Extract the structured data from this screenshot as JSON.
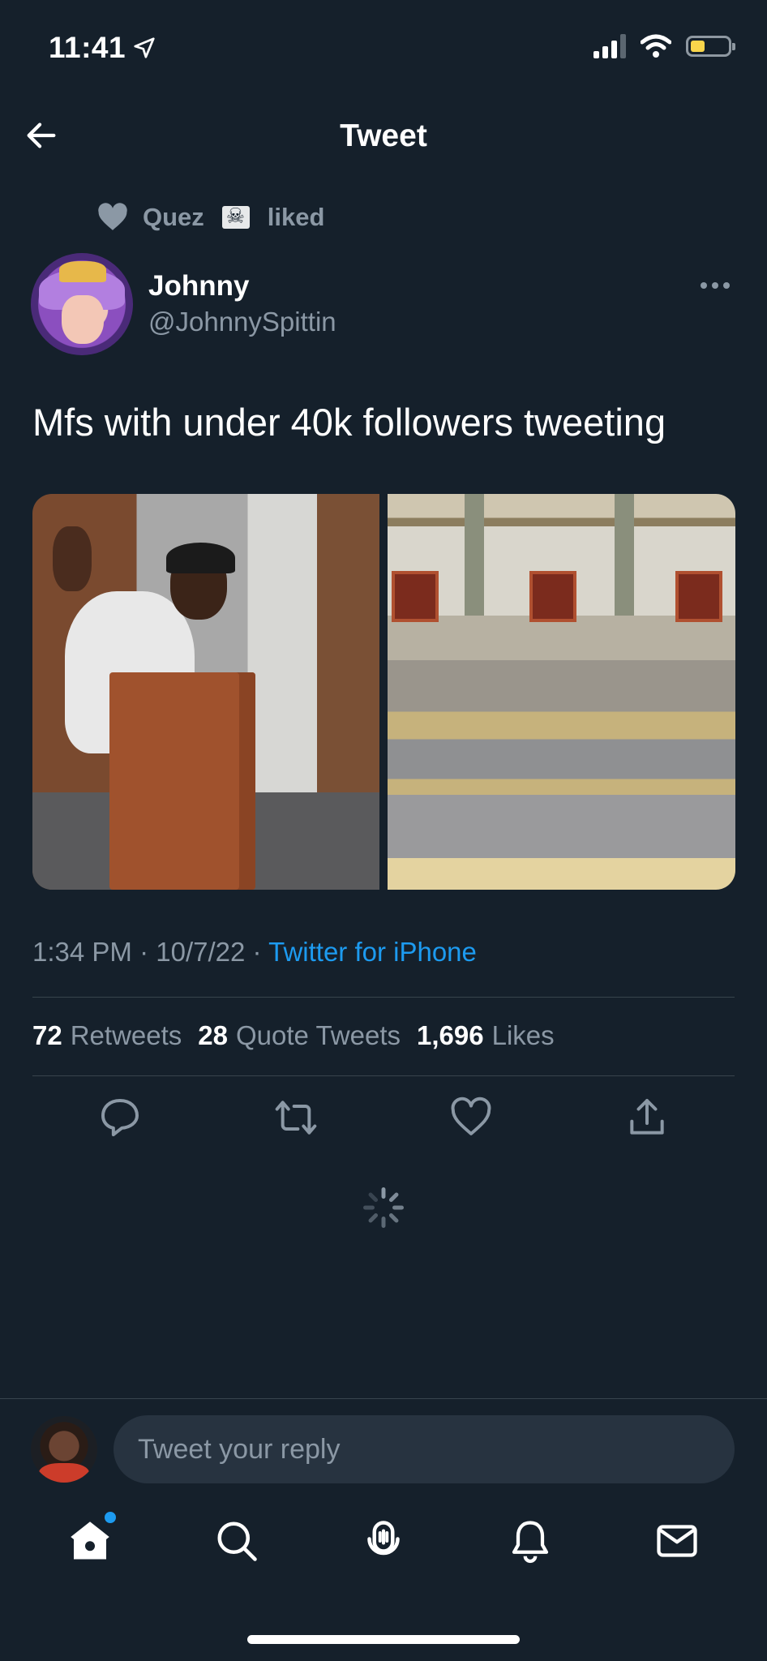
{
  "status_bar": {
    "time": "11:41"
  },
  "header": {
    "title": "Tweet"
  },
  "social_context": {
    "name": "Quez",
    "action": "liked"
  },
  "author": {
    "display_name": "Johnny",
    "handle": "@JohnnySpittin"
  },
  "tweet": {
    "text": "Mfs with under 40k followers tweeting",
    "time": "1:34 PM",
    "date": "10/7/22",
    "separator": "·",
    "source": "Twitter for iPhone"
  },
  "stats": {
    "retweets_count": "72",
    "retweets_label": "Retweets",
    "quotes_count": "28",
    "quotes_label": "Quote Tweets",
    "likes_count": "1,696",
    "likes_label": "Likes"
  },
  "reply": {
    "placeholder": "Tweet your reply"
  },
  "colors": {
    "background": "#15202b",
    "accent": "#1d9bf0",
    "secondary_text": "#8b98a5",
    "divider": "#38444d"
  },
  "icons": {
    "back": "arrow-left-icon",
    "more": "more-horizontal-icon",
    "actions": [
      "reply-icon",
      "retweet-icon",
      "like-icon",
      "share-icon"
    ],
    "tabs": [
      "home-icon",
      "search-icon",
      "spaces-icon",
      "notifications-icon",
      "messages-icon"
    ]
  }
}
